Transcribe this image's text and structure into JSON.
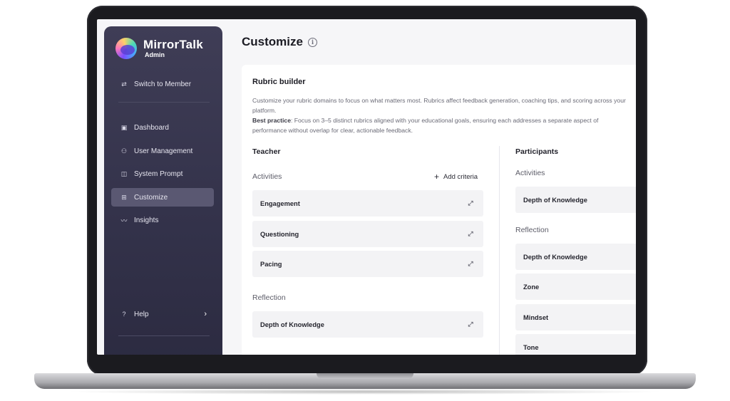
{
  "app": {
    "name": "MirrorTalk",
    "role": "Admin",
    "accent": "#5a5872"
  },
  "sidebar": {
    "switch": {
      "label": "Switch to Member",
      "icon": "switch-arrows-icon"
    },
    "items": [
      {
        "label": "Dashboard",
        "icon": "dashboard-icon",
        "active": false
      },
      {
        "label": "User Management",
        "icon": "users-icon",
        "active": false
      },
      {
        "label": "System Prompt",
        "icon": "book-icon",
        "active": false
      },
      {
        "label": "Customize",
        "icon": "customize-icon",
        "active": true
      },
      {
        "label": "Insights",
        "icon": "chart-line-icon",
        "active": false
      }
    ],
    "help": {
      "label": "Help",
      "icon": "help-circle-icon"
    }
  },
  "page": {
    "title": "Customize"
  },
  "rubric": {
    "title": "Rubric builder",
    "description": "Customize your rubric domains to focus on what matters most. Rubrics affect feedback generation, coaching tips, and scoring across your platform.",
    "best_practice_label": "Best practice",
    "best_practice_text": ": Focus on 3–5 distinct rubrics aligned with your educational goals, ensuring each addresses a separate aspect of performance without overlap for clear, actionable feedback."
  },
  "teacher": {
    "heading": "Teacher",
    "add_criteria": "Add criteria",
    "activities_label": "Activities",
    "activities": [
      "Engagement",
      "Questioning",
      "Pacing"
    ],
    "reflection_label": "Reflection",
    "reflection": [
      "Depth of Knowledge"
    ]
  },
  "participants": {
    "heading": "Participants",
    "activities_label": "Activities",
    "activities": [
      "Depth of Knowledge"
    ],
    "reflection_label": "Reflection",
    "reflection": [
      "Depth of Knowledge",
      "Zone",
      "Mindset",
      "Tone"
    ]
  }
}
